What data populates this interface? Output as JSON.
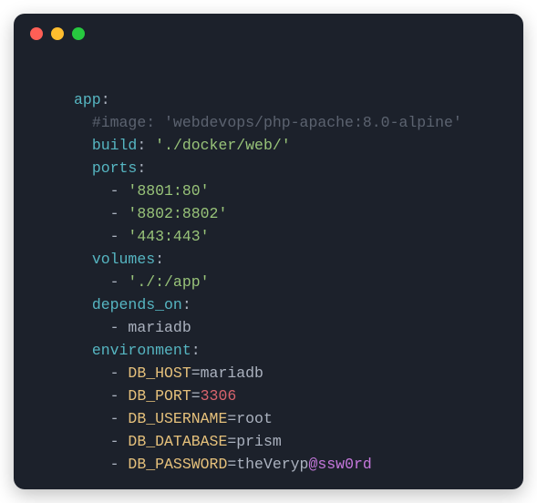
{
  "titlebar": {
    "red": "",
    "yellow": "",
    "green": ""
  },
  "yaml": {
    "appKey": "app",
    "commentLine": "#image: 'webdevops/php-apache:8.0-alpine'",
    "build": {
      "key": "build",
      "value": "'./docker/web/'"
    },
    "ports": {
      "key": "ports",
      "items": [
        "'8801:80'",
        "'8802:8802'",
        "'443:443'"
      ]
    },
    "volumes": {
      "key": "volumes",
      "items": [
        "'./:/app'"
      ]
    },
    "depends": {
      "key": "depends_on",
      "items": [
        "mariadb"
      ]
    },
    "env": {
      "key": "environment",
      "items": [
        {
          "var": "DB_HOST",
          "eq": "=",
          "val": "mariadb",
          "valClass": "d"
        },
        {
          "var": "DB_PORT",
          "eq": "=",
          "val": "3306",
          "valClass": "n"
        },
        {
          "var": "DB_USERNAME",
          "eq": "=",
          "val": "root",
          "valClass": "d"
        },
        {
          "var": "DB_DATABASE",
          "eq": "=",
          "val": "prism",
          "valClass": "d"
        }
      ],
      "password": {
        "var": "DB_PASSWORD",
        "eq": "=",
        "pre": "theVeryp",
        "at": "@ssw0rd"
      }
    }
  }
}
